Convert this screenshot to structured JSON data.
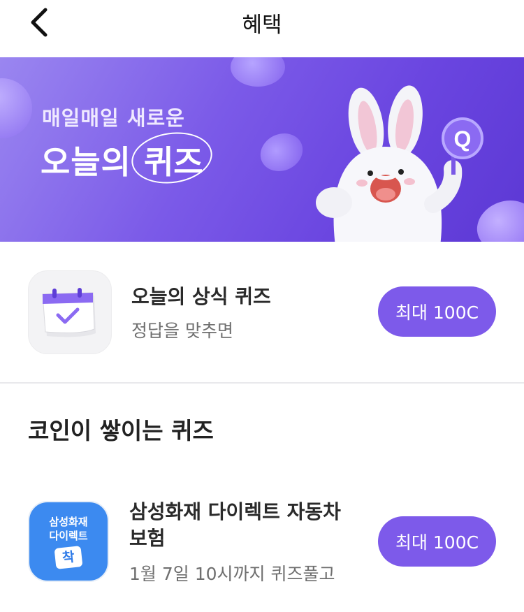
{
  "header": {
    "title": "혜택",
    "back_icon": "chevron-left-icon"
  },
  "banner": {
    "subtitle": "매일매일 새로운",
    "title": "오늘의",
    "title_emphasis": "퀴즈",
    "mascot_badge": "Q",
    "colors": {
      "start": "#9a86f0",
      "end": "#5c38d4"
    }
  },
  "daily_quiz": {
    "title": "오늘의 상식 퀴즈",
    "subtitle": "정답을 맞추면",
    "reward": "최대 100C",
    "icon": "calendar-check-icon"
  },
  "coin_section": {
    "title": "코인이 쌓이는 퀴즈",
    "items": [
      {
        "title_line1": "삼성화재 다이렉트 자동차",
        "title_line2": "보험",
        "subtitle": "1월 7일 10시까지 퀴즈풀고",
        "reward": "최대 100C",
        "logo_line1": "삼성화재",
        "logo_line2": "다이렉트",
        "logo_badge": "착"
      }
    ]
  },
  "colors": {
    "accent": "#7d5aea",
    "divider": "#e9e9ec",
    "samsung_blue": "#3c8af0"
  }
}
